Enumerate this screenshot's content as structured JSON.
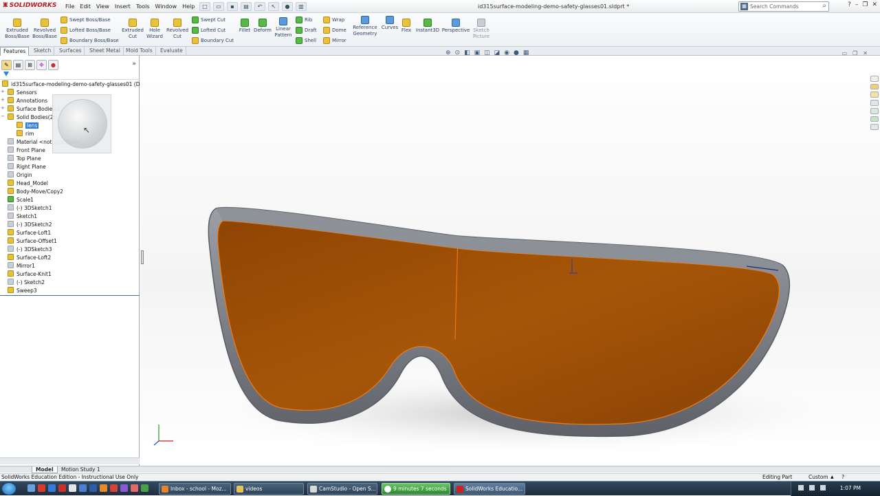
{
  "app": {
    "logo": "SOLIDWORKS",
    "menu": [
      "File",
      "Edit",
      "View",
      "Insert",
      "Tools",
      "Window",
      "Help"
    ],
    "document_title": "id315surface-modeling-demo-safety-glasses01.sldprt *",
    "search_placeholder": "Search Commands"
  },
  "ribbon": {
    "extruded_boss": "Extruded Boss/Base",
    "revolved_boss": "Revolved Boss/Base",
    "swept_boss": "Swept Boss/Base",
    "lofted_boss": "Lofted Boss/Base",
    "boundary_boss": "Boundary Boss/Base",
    "extruded_cut": "Extruded Cut",
    "hole_wizard": "Hole Wizard",
    "revolved_cut": "Revolved Cut",
    "swept_cut": "Swept Cut",
    "lofted_cut": "Lofted Cut",
    "boundary_cut": "Boundary Cut",
    "fillet": "Fillet",
    "deform": "Deform",
    "linear_pattern": "Linear Pattern",
    "rib": "Rib",
    "draft": "Draft",
    "shell": "Shell",
    "wrap": "Wrap",
    "dome": "Dome",
    "mirror": "Mirror",
    "reference_geometry": "Reference Geometry",
    "curves": "Curves",
    "flex": "Flex",
    "instant3d": "Instant3D",
    "perspective": "Perspective",
    "sketch_picture": "Sketch Picture"
  },
  "command_tabs": [
    "Features",
    "Sketch",
    "Surfaces",
    "Sheet Metal",
    "Mold Tools",
    "Evaluate"
  ],
  "feature_tree": {
    "root": "id315surface-modeling-demo-safety-glasses01  (D",
    "items": [
      {
        "label": "Sensors"
      },
      {
        "label": "Annotations"
      },
      {
        "label": "Surface Bodies(1)"
      },
      {
        "label": "Solid Bodies(2)"
      },
      {
        "label": "lens"
      },
      {
        "label": "rim"
      },
      {
        "label": "Material <not specified>"
      },
      {
        "label": "Front Plane"
      },
      {
        "label": "Top Plane"
      },
      {
        "label": "Right Plane"
      },
      {
        "label": "Origin"
      },
      {
        "label": "Head_Model"
      },
      {
        "label": "Body-Move/Copy2"
      },
      {
        "label": "Scale1"
      },
      {
        "label": "(-) 3DSketch1"
      },
      {
        "label": "Sketch1"
      },
      {
        "label": "(-) 3DSketch2"
      },
      {
        "label": "Surface-Loft1"
      },
      {
        "label": "Surface-Offset1"
      },
      {
        "label": "(-) 3DSketch3"
      },
      {
        "label": "Surface-Loft2"
      },
      {
        "label": "Mirror1"
      },
      {
        "label": "Surface-Knit1"
      },
      {
        "label": "(-) Sketch2"
      },
      {
        "label": "Sweep3"
      }
    ]
  },
  "model_tabs": [
    "Model",
    "Motion Study 1"
  ],
  "status": {
    "left": "SolidWorks Education Edition - Instructional Use Only",
    "mode": "Editing Part",
    "units": "Custom"
  },
  "taskbar": {
    "items": [
      "Inbox - school - Moz...",
      "videos",
      "CamStudio - Open S...",
      "9 minutes 7 seconds",
      "SolidWorks Educatio..."
    ],
    "clock": "1:07 PM"
  },
  "colors": {
    "lens_tint": "#9a4e05",
    "frame": "#7a7e84",
    "edge_highlight": "#f07a18"
  }
}
